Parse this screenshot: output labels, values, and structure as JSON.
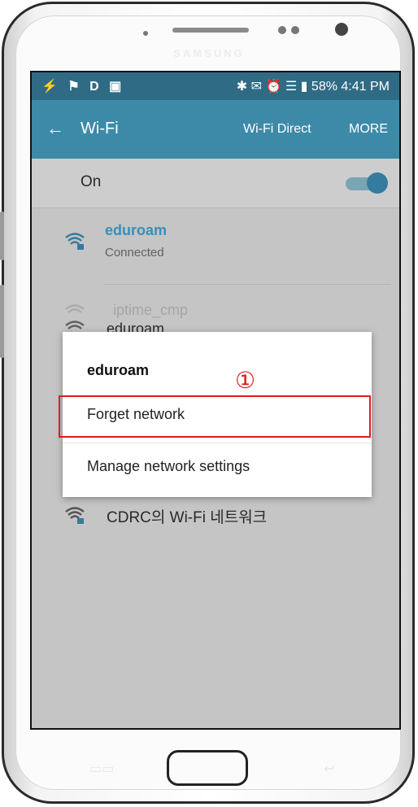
{
  "device": {
    "brand": "SAMSUNG"
  },
  "status_bar": {
    "left_icons": "⚡ ⚑ D ▣",
    "right_icons": "✱ ✉ ⏰ ☰ ▮",
    "battery": "58%",
    "time": "4:41 PM"
  },
  "app_bar": {
    "back_icon": "←",
    "title": "Wi-Fi",
    "actions": [
      "Wi-Fi Direct",
      "MORE"
    ]
  },
  "wifi_toggle": {
    "label": "On",
    "state": "on"
  },
  "networks": [
    {
      "name": "eduroam",
      "status": "Connected"
    },
    {
      "name": "iptime_cmp",
      "status": ""
    },
    {
      "name": "eduroam",
      "status": ""
    },
    {
      "name": "CDRC의 Wi-Fi 네트워크",
      "status": ""
    }
  ],
  "dialog": {
    "title": "eduroam",
    "items": [
      "Forget network",
      "Manage network settings"
    ],
    "marker": "①"
  },
  "colors": {
    "status_bar": "#2f6b84",
    "app_bar": "#3d8aa8",
    "connected_accent": "#2fa0d4",
    "highlight": "#e11b1b"
  }
}
